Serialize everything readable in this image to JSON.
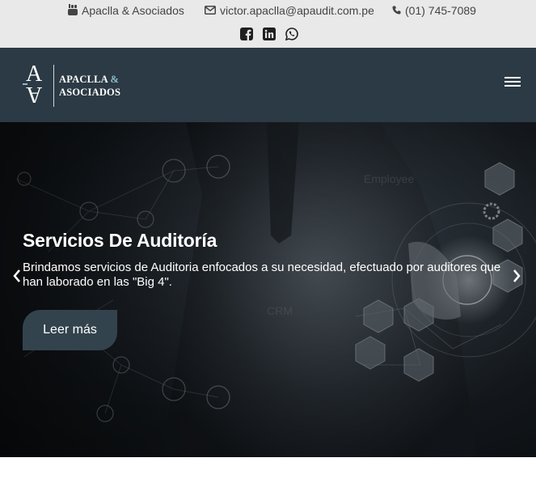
{
  "topbar": {
    "company_name": "Apaclla & Asociados",
    "email": "victor.apaclla@apaudit.com.pe",
    "phone": "(01) 745-7089",
    "icons": {
      "youtube": "youtube-icon",
      "email": "envelope-icon",
      "phone": "phone-icon",
      "facebook": "facebook-icon",
      "linkedin": "linkedin-icon",
      "whatsapp": "whatsapp-icon"
    }
  },
  "navbar": {
    "logo_line1": "APACLLA",
    "logo_amp": "&",
    "logo_line2": "ASOCIADOS",
    "menu_icon": "hamburger-menu-icon",
    "background": "#2b3a44"
  },
  "hero": {
    "title": "Servicios De Auditoría",
    "description": "Brindamos servicios de Auditoria enfocados a su necesidad, efectuado por auditores que han laborado en las \"Big 4\".",
    "button_label": "Leer más",
    "prev_icon": "chevron-left-icon",
    "next_icon": "chevron-right-icon"
  },
  "colors": {
    "topbar_bg": "#e9e9e9",
    "navbar_bg": "#2b3a44",
    "button_bg": "#33434d",
    "accent": "#8fb9c8"
  }
}
